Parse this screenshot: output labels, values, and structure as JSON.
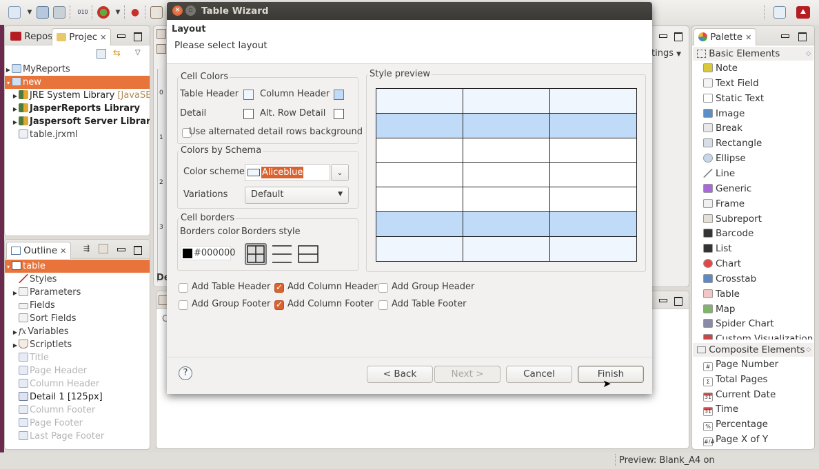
{
  "dialog": {
    "title": "Table Wizard",
    "header_title": "Layout",
    "header_subtitle": "Please select layout",
    "cell_colors": {
      "label": "Cell Colors",
      "table_header_label": "Table Header",
      "table_header_color": "#f0f6fd",
      "column_header_label": "Column Header",
      "column_header_color": "#bfdbf7",
      "detail_label": "Detail",
      "detail_color": "#ffffff",
      "alt_row_detail_label": "Alt. Row Detail",
      "alt_row_detail_color": "#ffffff",
      "use_alternated_label": "Use alternated detail rows background",
      "use_alternated_checked": false
    },
    "colors_by_schema": {
      "label": "Colors by Schema",
      "color_scheme_label": "Color scheme",
      "color_scheme_value": "Aliceblue",
      "variations_label": "Variations",
      "variations_value": "Default"
    },
    "cell_borders": {
      "label": "Cell borders",
      "borders_color_label": "Borders color",
      "borders_color_value": "#000000",
      "borders_style_label": "Borders style",
      "styles": [
        "all-borders",
        "horizontal-only",
        "outer-with-horizontal"
      ],
      "selected_style": "all-borders"
    },
    "style_preview": {
      "label": "Style preview",
      "rows": [
        "table-header",
        "column-header",
        "detail",
        "detail",
        "detail",
        "column-footer",
        "table-footer"
      ],
      "columns": 3,
      "row_colors": [
        "#f0f6fd",
        "#bfdbf7",
        "#ffffff",
        "#ffffff",
        "#ffffff",
        "#bfdbf7",
        "#f0f6fd"
      ]
    },
    "options": [
      {
        "label": "Add Table Header",
        "checked": false
      },
      {
        "label": "Add Column Header",
        "checked": true
      },
      {
        "label": "Add Group Header",
        "checked": false
      },
      {
        "label": "Add Group Footer",
        "checked": false
      },
      {
        "label": "Add Column Footer",
        "checked": true
      },
      {
        "label": "Add Table Footer",
        "checked": false
      }
    ],
    "buttons": {
      "help": "?",
      "back": "< Back",
      "next": "Next >",
      "cancel": "Cancel",
      "finish": "Finish"
    }
  },
  "project_panel": {
    "tabs": [
      "Repos",
      "Projec"
    ],
    "tree": [
      {
        "label": "MyReports",
        "expandable": true,
        "selected": false
      },
      {
        "label": "new",
        "expandable": true,
        "selected": true
      },
      {
        "label": "JRE System Library",
        "suffix": "[JavaSE-",
        "expandable": true
      },
      {
        "label": "JasperReports Library",
        "expandable": true
      },
      {
        "label": "Jaspersoft Server Library",
        "expandable": true
      },
      {
        "label": "table.jrxml",
        "expandable": false
      }
    ]
  },
  "outline_panel": {
    "tab": "Outline",
    "tree": [
      {
        "label": "table",
        "selected": true
      },
      {
        "label": "Styles"
      },
      {
        "label": "Parameters",
        "expandable": true
      },
      {
        "label": "Fields"
      },
      {
        "label": "Sort Fields"
      },
      {
        "label": "Variables",
        "expandable": true
      },
      {
        "label": "Scriptlets",
        "expandable": true
      },
      {
        "label": "Title",
        "dimmed": true
      },
      {
        "label": "Page Header",
        "dimmed": true
      },
      {
        "label": "Column Header",
        "dimmed": true
      },
      {
        "label": "Detail 1 [125px]",
        "dimmed": false
      },
      {
        "label": "Column Footer",
        "dimmed": true
      },
      {
        "label": "Page Footer",
        "dimmed": true
      },
      {
        "label": "Last Page Footer",
        "dimmed": true
      }
    ]
  },
  "editor": {
    "tab_partial": "De",
    "lower_tab_partial": "C",
    "settings_partial": "tings",
    "ruler_labels": [
      "0",
      "1",
      "2",
      "3"
    ]
  },
  "palette": {
    "tab": "Palette",
    "basic_group": "Basic Elements",
    "basic_items": [
      "Note",
      "Text Field",
      "Static Text",
      "Image",
      "Break",
      "Rectangle",
      "Ellipse",
      "Line",
      "Generic",
      "Frame",
      "Subreport",
      "Barcode",
      "List",
      "Chart",
      "Crosstab",
      "Table",
      "Map",
      "Spider Chart",
      "Custom Visualization"
    ],
    "composite_group": "Composite Elements",
    "composite_items": [
      "Page Number",
      "Total Pages",
      "Current Date",
      "Time",
      "Percentage",
      "Page X of Y"
    ]
  },
  "status_bar": {
    "text": "Preview: Blank_A4 on"
  }
}
